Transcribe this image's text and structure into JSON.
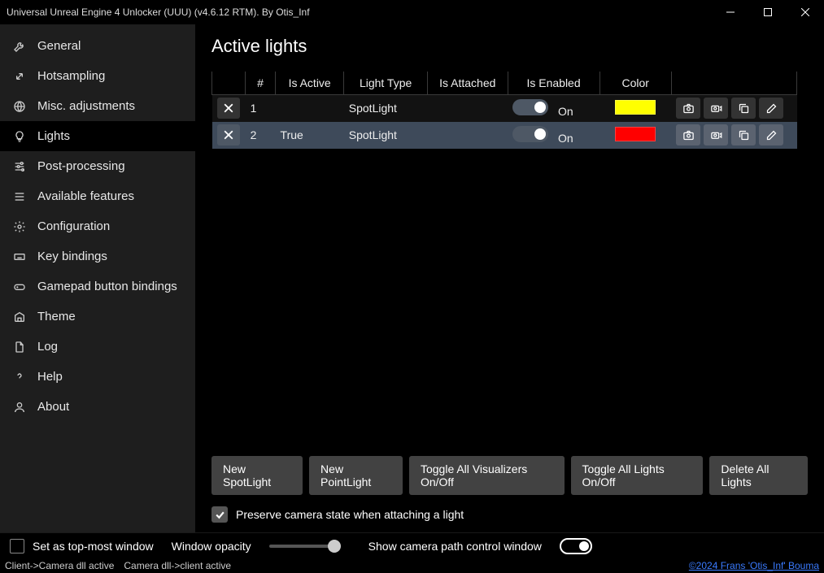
{
  "window": {
    "title": "Universal Unreal Engine 4 Unlocker (UUU) (v4.6.12 RTM). By Otis_Inf"
  },
  "sidebar": {
    "items": [
      {
        "label": "General"
      },
      {
        "label": "Hotsampling"
      },
      {
        "label": "Misc. adjustments"
      },
      {
        "label": "Lights"
      },
      {
        "label": "Post-processing"
      },
      {
        "label": "Available features"
      },
      {
        "label": "Configuration"
      },
      {
        "label": "Key bindings"
      },
      {
        "label": "Gamepad button bindings"
      },
      {
        "label": "Theme"
      },
      {
        "label": "Log"
      },
      {
        "label": "Help"
      },
      {
        "label": "About"
      }
    ]
  },
  "main": {
    "title": "Active lights",
    "columns": [
      "",
      "#",
      "Is Active",
      "Light Type",
      "Is Attached",
      "Is Enabled",
      "Color",
      ""
    ],
    "rows": [
      {
        "num": "1",
        "is_active": "",
        "light_type": "SpotLight",
        "is_attached": "",
        "enabled_label": "On",
        "color": "#ffff00"
      },
      {
        "num": "2",
        "is_active": "True",
        "light_type": "SpotLight",
        "is_attached": "",
        "enabled_label": "On",
        "color": "#ff0000"
      }
    ],
    "buttons": {
      "new_spot": "New SpotLight",
      "new_point": "New PointLight",
      "toggle_viz": "Toggle All Visualizers On/Off",
      "toggle_lights": "Toggle All Lights On/Off",
      "delete_all": "Delete All Lights"
    },
    "preserve_label": "Preserve camera state when attaching a light"
  },
  "bottom": {
    "topmost": "Set as top-most window",
    "opacity_label": "Window opacity",
    "show_camera": "Show camera path control window"
  },
  "status": {
    "s1": "Client->Camera dll active",
    "s2": "Camera dll->client active",
    "copyright": "©2024 Frans 'Otis_Inf' Bouma"
  }
}
